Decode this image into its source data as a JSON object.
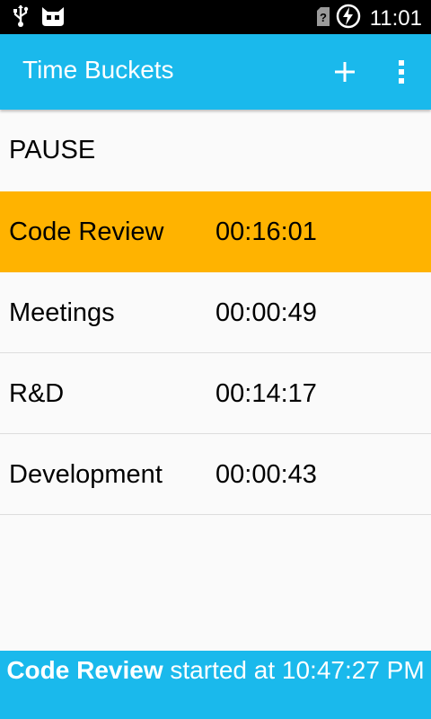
{
  "status_bar": {
    "time": "11:01",
    "icons": [
      "usb-icon",
      "cyanogenmod-icon",
      "no-sim-icon",
      "battery-charging-icon"
    ]
  },
  "app_bar": {
    "title": "Time Buckets",
    "actions": [
      "add-icon",
      "overflow-menu-icon"
    ],
    "color": "#1ab9ec"
  },
  "pause": {
    "label": "PAUSE"
  },
  "buckets": [
    {
      "name": "Code Review",
      "time": "00:16:01",
      "active": true
    },
    {
      "name": "Meetings",
      "time": "00:00:49",
      "active": false
    },
    {
      "name": "R&D",
      "time": "00:14:17",
      "active": false
    },
    {
      "name": "Development",
      "time": "00:00:43",
      "active": false
    }
  ],
  "footer": {
    "bucket": "Code Review",
    "message": " started at 10:47:27 PM"
  },
  "colors": {
    "active_row": "#ffb300",
    "accent": "#1ab9ec"
  }
}
